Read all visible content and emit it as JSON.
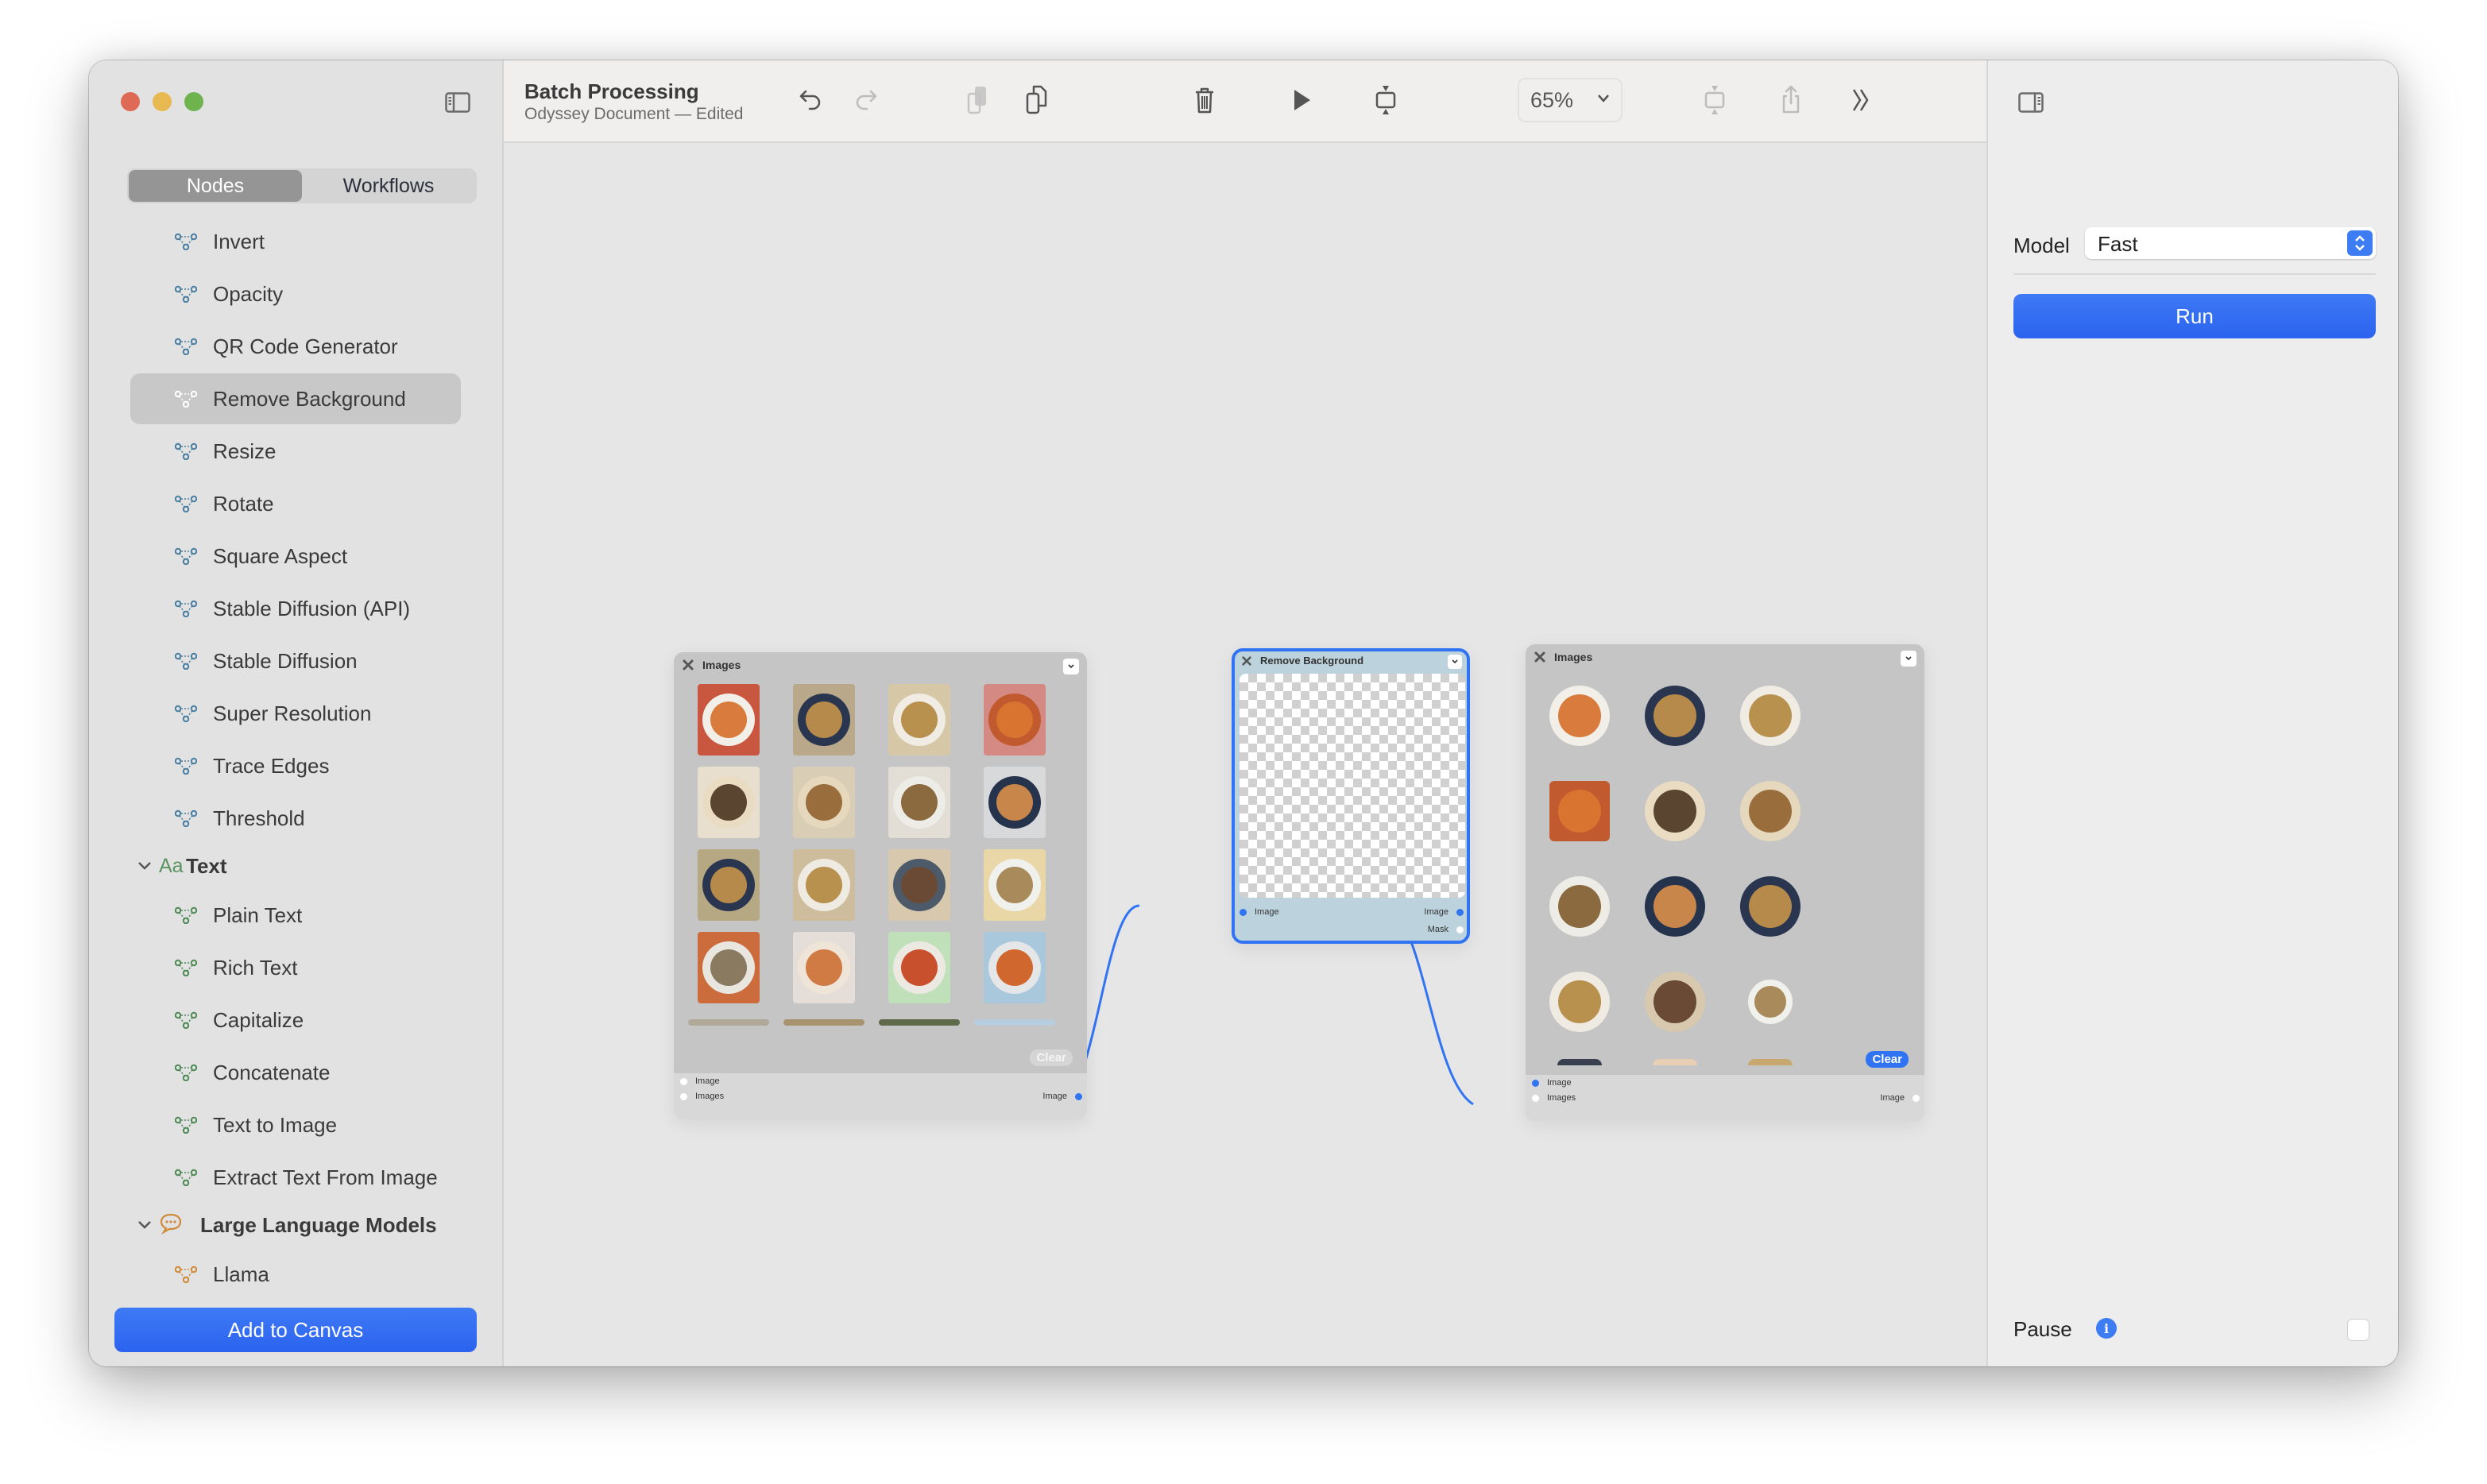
{
  "window": {
    "title": "Batch Processing",
    "subtitle": "Odyssey Document — Edited"
  },
  "sidebar": {
    "tabs": [
      {
        "label": "Nodes",
        "active": true
      },
      {
        "label": "Workflows",
        "active": false
      }
    ],
    "items": [
      {
        "type": "node",
        "label": "Invert",
        "icon": "node-graph-icon",
        "color": "#4a7fa0"
      },
      {
        "type": "node",
        "label": "Opacity",
        "icon": "node-graph-icon",
        "color": "#4a7fa0"
      },
      {
        "type": "node",
        "label": "QR Code Generator",
        "icon": "node-graph-icon",
        "color": "#4a7fa0"
      },
      {
        "type": "node",
        "label": "Remove Background",
        "icon": "node-graph-icon",
        "color": "#ffffff",
        "selected": true
      },
      {
        "type": "node",
        "label": "Resize",
        "icon": "node-graph-icon",
        "color": "#4a7fa0"
      },
      {
        "type": "node",
        "label": "Rotate",
        "icon": "node-graph-icon",
        "color": "#4a7fa0"
      },
      {
        "type": "node",
        "label": "Square Aspect",
        "icon": "node-graph-icon",
        "color": "#4a7fa0"
      },
      {
        "type": "node",
        "label": "Stable Diffusion (API)",
        "icon": "node-graph-icon",
        "color": "#4a7fa0"
      },
      {
        "type": "node",
        "label": "Stable Diffusion",
        "icon": "node-graph-icon",
        "color": "#4a7fa0"
      },
      {
        "type": "node",
        "label": "Super Resolution",
        "icon": "node-graph-icon",
        "color": "#4a7fa0"
      },
      {
        "type": "node",
        "label": "Trace Edges",
        "icon": "node-graph-icon",
        "color": "#4a7fa0"
      },
      {
        "type": "node",
        "label": "Threshold",
        "icon": "node-graph-icon",
        "color": "#4a7fa0"
      },
      {
        "type": "group",
        "label": "Text",
        "icon": "text-aa-icon",
        "glyph": "Aa",
        "color": "#5a9460",
        "expanded": true
      },
      {
        "type": "node",
        "label": "Plain Text",
        "icon": "node-graph-icon",
        "color": "#4f8a57"
      },
      {
        "type": "node",
        "label": "Rich Text",
        "icon": "node-graph-icon",
        "color": "#4f8a57"
      },
      {
        "type": "node",
        "label": "Capitalize",
        "icon": "node-graph-icon",
        "color": "#4f8a57"
      },
      {
        "type": "node",
        "label": "Concatenate",
        "icon": "node-graph-icon",
        "color": "#4f8a57"
      },
      {
        "type": "node",
        "label": "Text to Image",
        "icon": "node-graph-icon",
        "color": "#4f8a57"
      },
      {
        "type": "node",
        "label": "Extract Text From Image",
        "icon": "node-graph-icon",
        "color": "#4f8a57"
      },
      {
        "type": "group",
        "label": "Large Language Models",
        "icon": "speech-bubble-icon",
        "glyph": "💬",
        "color": "#d08a3a",
        "expanded": true
      },
      {
        "type": "node",
        "label": "Llama",
        "icon": "node-graph-icon",
        "color": "#d08a3a"
      }
    ],
    "add_button": "Add to Canvas"
  },
  "toolbar": {
    "buttons": [
      {
        "name": "undo-button",
        "icon": "undo-icon",
        "enabled": true
      },
      {
        "name": "redo-button",
        "icon": "redo-icon",
        "enabled": false
      },
      {
        "name": "copy-button",
        "icon": "copy-icon",
        "enabled": false
      },
      {
        "name": "duplicate-button",
        "icon": "duplicate-icon",
        "enabled": true
      },
      {
        "name": "delete-button",
        "icon": "trash-icon",
        "enabled": true
      },
      {
        "name": "play-button",
        "icon": "play-icon",
        "enabled": true
      },
      {
        "name": "fit-vertical-button",
        "icon": "fit-vertical-icon",
        "enabled": true
      },
      {
        "name": "fit-horizontal-button",
        "icon": "fit-vertical-icon",
        "enabled": false
      },
      {
        "name": "share-button",
        "icon": "share-icon",
        "enabled": false
      },
      {
        "name": "more-button",
        "icon": "chevron-double-right-icon",
        "enabled": true
      }
    ],
    "zoom": "65%"
  },
  "canvas": {
    "accent": "#3174f3",
    "nodes": [
      {
        "id": "images-input",
        "title": "Images",
        "inputs": [
          "Image",
          "Images"
        ],
        "outputs": [
          "Image"
        ],
        "clear_label": "Clear",
        "thumbnails": 20
      },
      {
        "id": "remove-background",
        "title": "Remove Background",
        "selected": true,
        "inputs": [
          "Image"
        ],
        "outputs": [
          "Image",
          "Mask"
        ]
      },
      {
        "id": "images-output",
        "title": "Images",
        "inputs": [
          "Image",
          "Images"
        ],
        "outputs": [
          "Image"
        ],
        "clear_label": "Clear",
        "thumbnails": 15
      }
    ],
    "connections": [
      {
        "from": "images-input.Image",
        "to": "remove-background.Image"
      },
      {
        "from": "remove-background.Image",
        "to": "images-output.Image"
      }
    ]
  },
  "inspector": {
    "model_label": "Model",
    "model_value": "Fast",
    "run_label": "Run",
    "pause_label": "Pause",
    "pause_checked": false,
    "info_glyph": "i"
  }
}
